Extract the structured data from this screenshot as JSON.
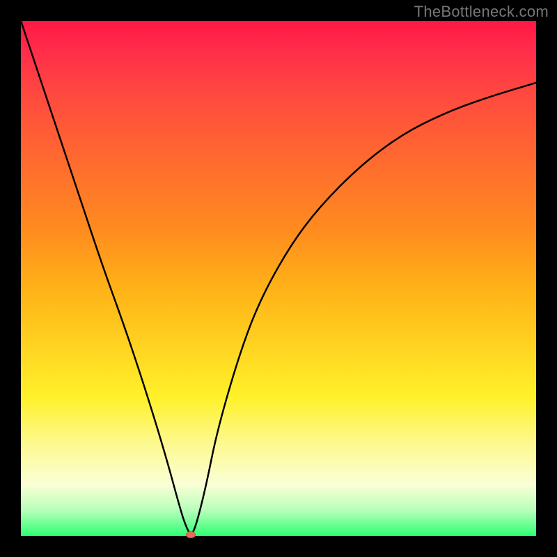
{
  "attribution": "TheBottleneck.com",
  "colors": {
    "frame": "#000000",
    "curve": "#000000",
    "marker": "#e36b5a",
    "gradient_stops": [
      "#ff1744",
      "#ff6a2f",
      "#ffd321",
      "#fdf98f",
      "#2dff72"
    ]
  },
  "chart_data": {
    "type": "line",
    "title": "",
    "xlabel": "",
    "ylabel": "",
    "xlim": [
      0,
      100
    ],
    "ylim": [
      0,
      100
    ],
    "grid": false,
    "legend": false,
    "marker": {
      "x": 33,
      "y": 0,
      "color": "#e36b5a"
    },
    "series": [
      {
        "name": "bottleneck-curve",
        "x": [
          0,
          4,
          8,
          12,
          16,
          20,
          24,
          28,
          31,
          32,
          33,
          34,
          36,
          38,
          42,
          46,
          52,
          58,
          66,
          74,
          82,
          90,
          100
        ],
        "y": [
          100,
          88,
          76,
          64,
          52,
          41,
          29,
          16,
          5,
          2,
          0,
          2,
          10,
          20,
          34,
          45,
          56,
          64,
          72,
          78,
          82,
          85,
          88
        ]
      }
    ],
    "notes": "V-shaped bottleneck curve on rainbow gradient; minimum at x≈33."
  }
}
